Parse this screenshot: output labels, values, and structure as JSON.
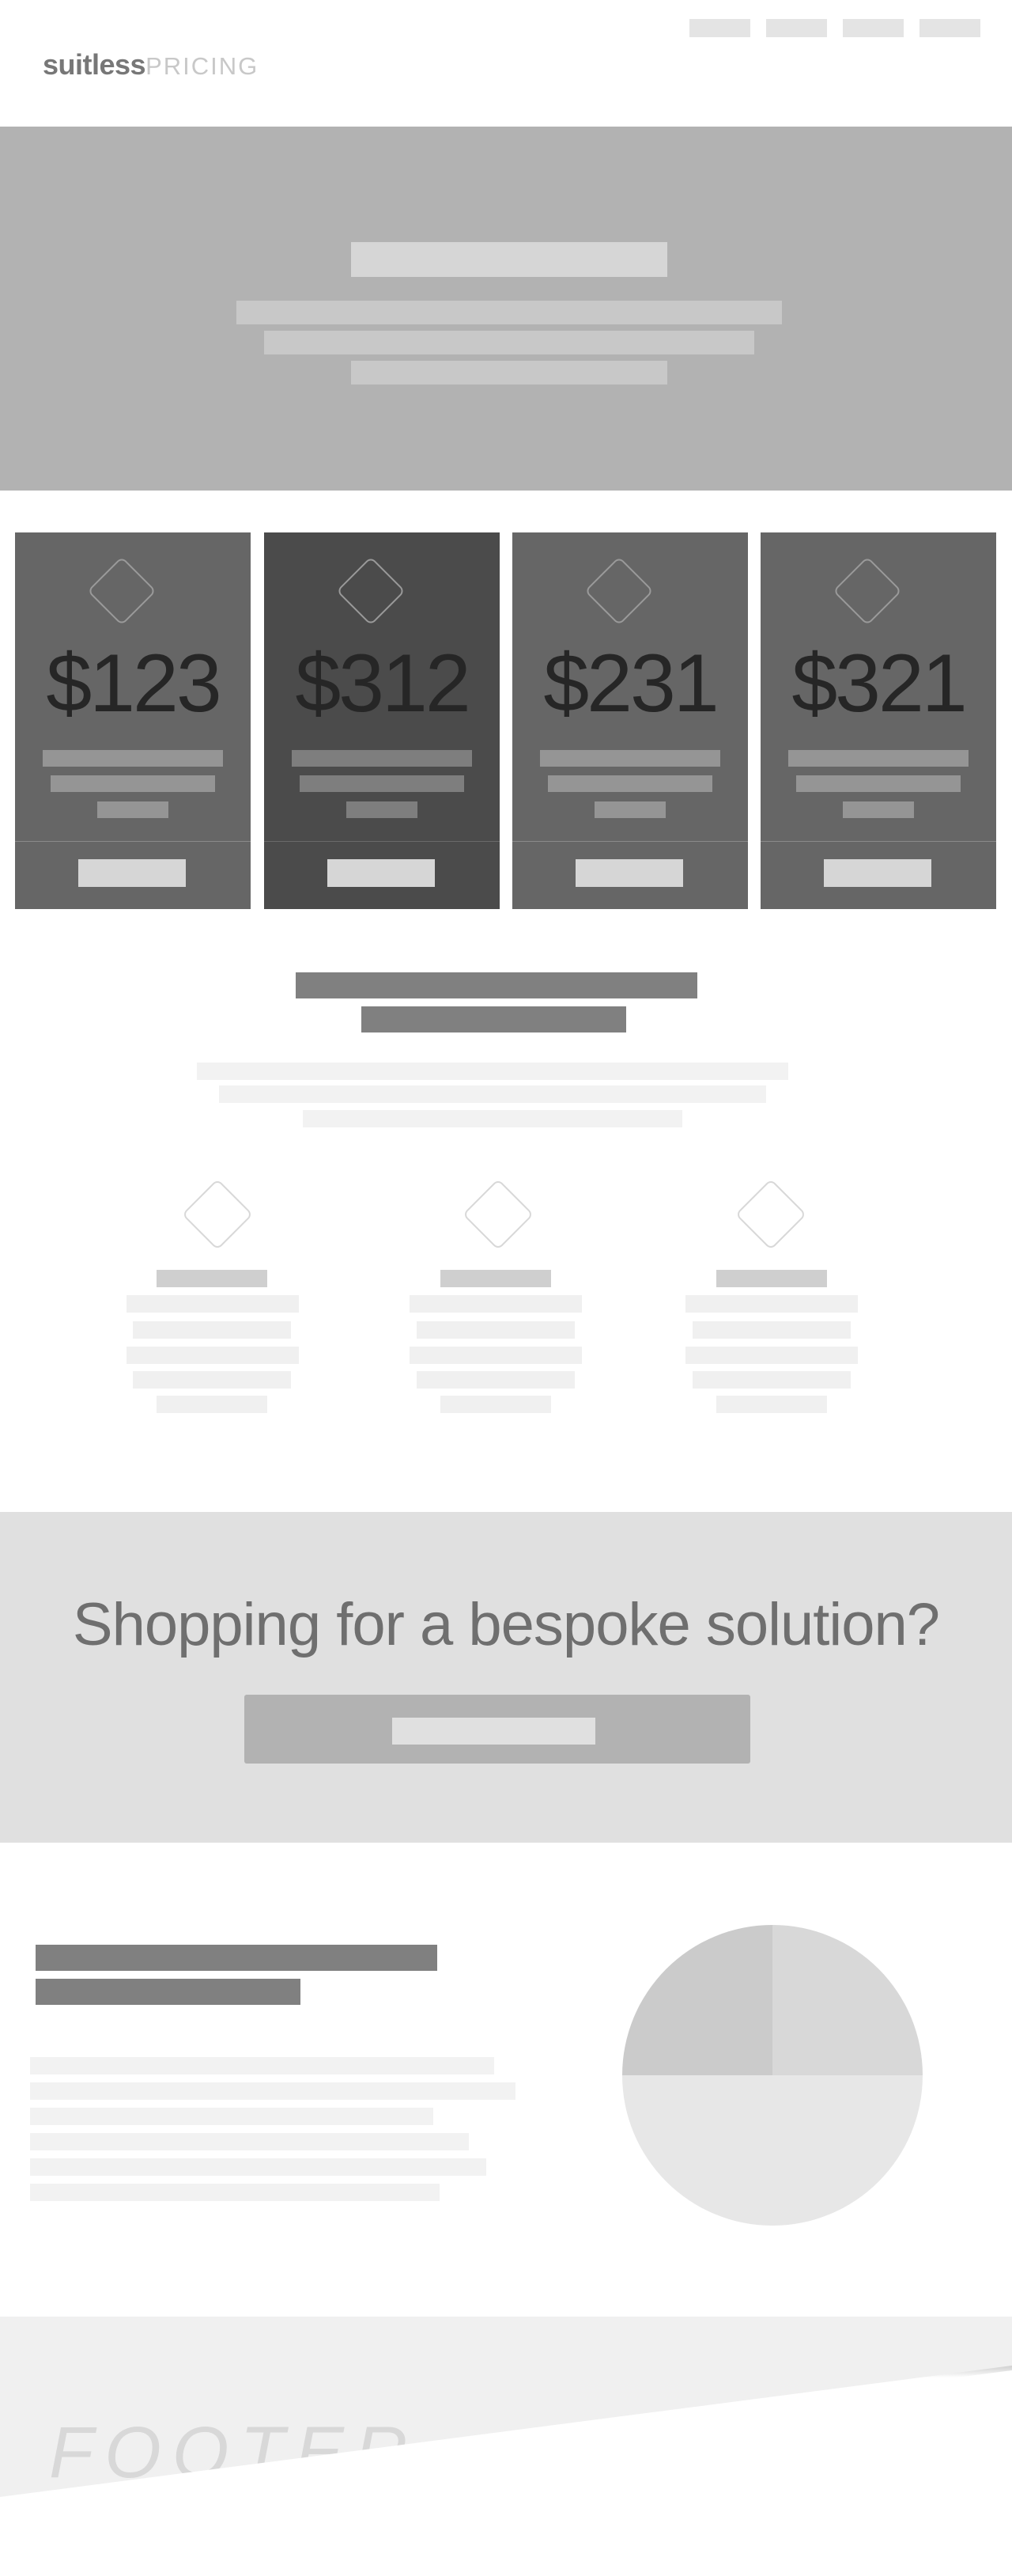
{
  "header": {
    "brand": "suitless",
    "brand_suffix": "PRICING",
    "nav_items": 4
  },
  "plans": [
    {
      "price": "$123",
      "featured": false
    },
    {
      "price": "$312",
      "featured": true
    },
    {
      "price": "$231",
      "featured": false
    },
    {
      "price": "$321",
      "featured": false
    }
  ],
  "banner": {
    "title": "Shopping for a bespoke solution?"
  },
  "footer": {
    "label": "FOOTER"
  },
  "pie": {
    "slices": [
      {
        "fraction": 0.25,
        "color": "#d8d8d8"
      },
      {
        "fraction": 0.5,
        "color": "#e7e7e7"
      },
      {
        "fraction": 0.25,
        "color": "#cbcbcb"
      }
    ]
  },
  "colors": {
    "hero": "#b2b2b2",
    "card": "#666666",
    "card_featured": "#4b4b4b",
    "banner": "#e0e0e0",
    "footer": "#f0f0f0"
  }
}
